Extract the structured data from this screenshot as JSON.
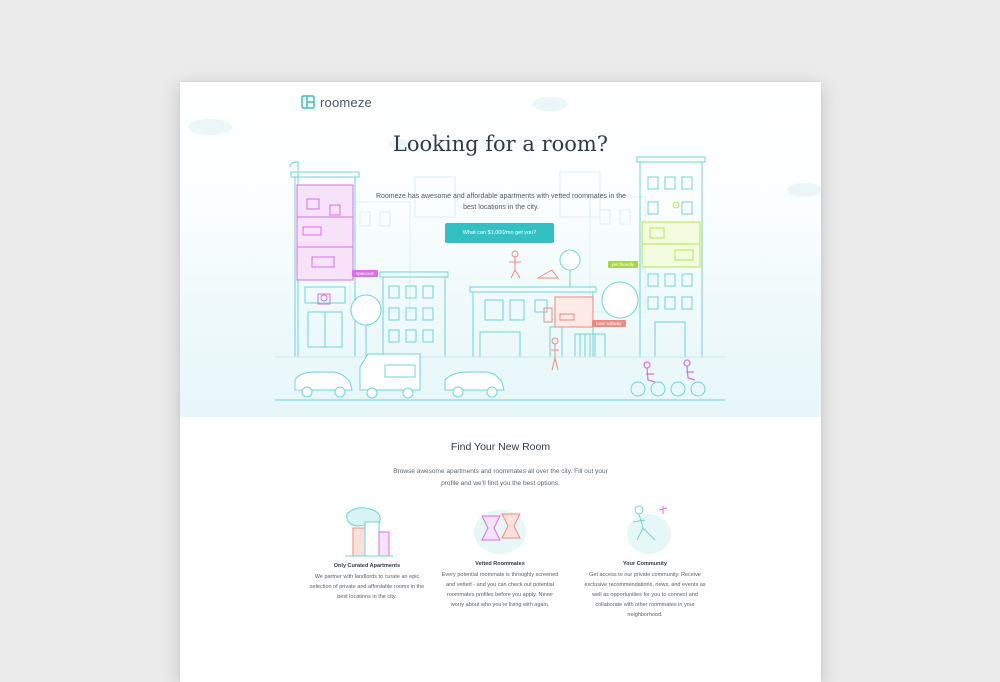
{
  "app": {
    "logo_text": "roomeze"
  },
  "hero": {
    "title": "Looking for a room?",
    "subtitle": "Roomeze has awesome and affordable apartments with vetted roommates in the best locations in the city.",
    "cta_label": "What can $1,000/mo get you?",
    "tags": [
      "spacious",
      "pet friendly",
      "near subway"
    ]
  },
  "find": {
    "title": "Find Your New Room",
    "subtitle": "Browse awesome apartments and roommates all over the city. Fill out your profile and we'll find you the best options."
  },
  "features": [
    {
      "title": "Only Curated Apartments",
      "description": "We partner with landlords to curate an epic selection of private and affordable rooms in the best locations in the city.",
      "icon": "buildings-icon"
    },
    {
      "title": "Vetted Roommates",
      "description": "Every potential roommate is throughly screened and vetted - and you can check out potential roommates profiles before you apply. Never worry about who you're living with again.",
      "icon": "roommates-icon"
    },
    {
      "title": "Your Community",
      "description": "Get access to our private community. Receive exclusive recommendations, news, and events as well as opportunities for you to connect and collaborate with other roommates in your neighborhood.",
      "icon": "community-icon"
    }
  ],
  "colors": {
    "teal": "#34c0c3",
    "magenta": "#d96fe6",
    "lime": "#b6e84a",
    "coral": "#f08a7e",
    "page_bg": "#ebebeb"
  }
}
